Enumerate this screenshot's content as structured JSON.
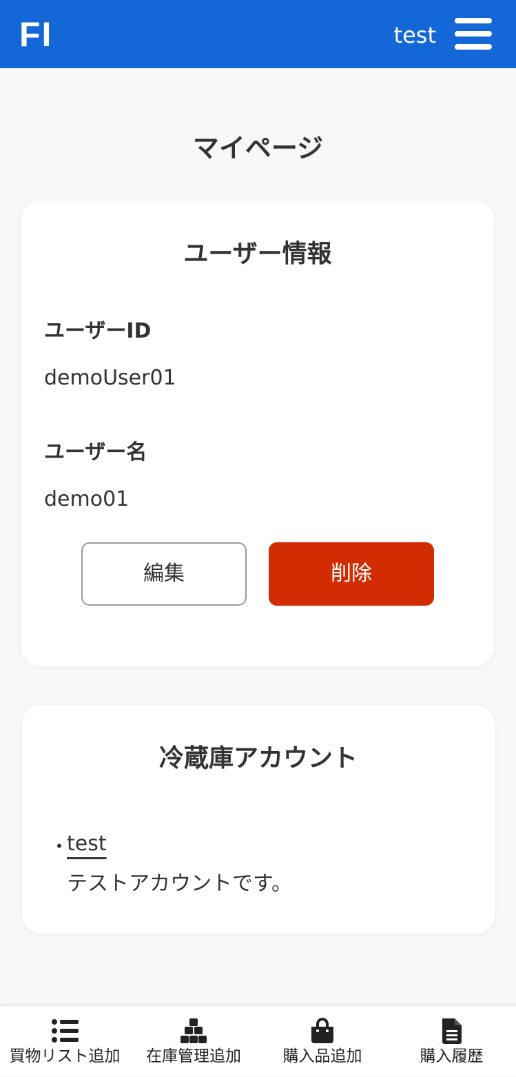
{
  "header": {
    "logo": "FI",
    "username": "test",
    "menu_icon": "hamburger-menu-icon"
  },
  "page": {
    "title": "マイページ"
  },
  "user_info": {
    "title": "ユーザー情報",
    "user_id_label": "ユーザーID",
    "user_id_value": "demoUser01",
    "user_name_label": "ユーザー名",
    "user_name_value": "demo01",
    "edit_label": "編集",
    "delete_label": "削除"
  },
  "fridge_accounts": {
    "title": "冷蔵庫アカウント",
    "items": [
      {
        "bullet": "・",
        "name": "test",
        "description": "テストアカウントです。"
      }
    ]
  },
  "bottom_nav": {
    "items": [
      {
        "label": "買物リスト追加",
        "icon": "list-icon"
      },
      {
        "label": "在庫管理追加",
        "icon": "boxes-icon"
      },
      {
        "label": "購入品追加",
        "icon": "shopping-bag-icon"
      },
      {
        "label": "購入履歴",
        "icon": "document-icon"
      }
    ]
  },
  "colors": {
    "header_bg": "#1467d6",
    "delete_bg": "#d12c02",
    "page_bg": "#f8f8f8"
  }
}
